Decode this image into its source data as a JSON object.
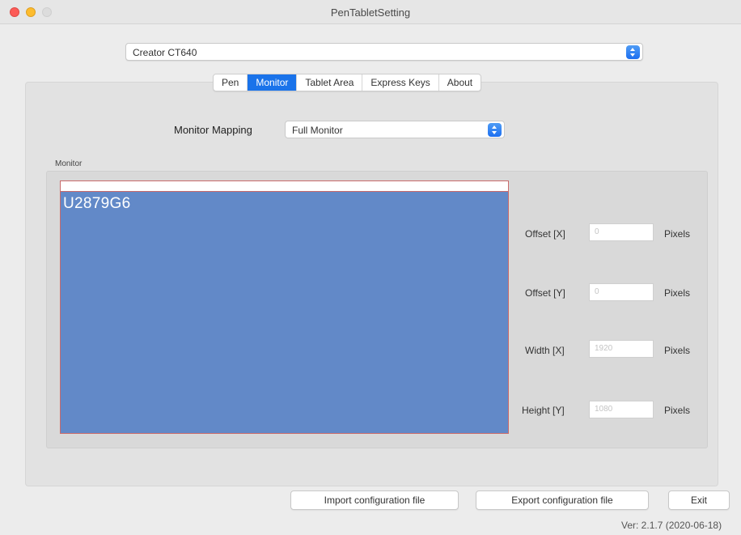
{
  "window": {
    "title": "PenTabletSetting"
  },
  "device": {
    "selected": "Creator CT640"
  },
  "tabs": [
    {
      "label": "Pen",
      "active": false
    },
    {
      "label": "Monitor",
      "active": true
    },
    {
      "label": "Tablet Area",
      "active": false
    },
    {
      "label": "Express Keys",
      "active": false
    },
    {
      "label": "About",
      "active": false
    }
  ],
  "monitor_mapping": {
    "label": "Monitor Mapping",
    "selected": "Full Monitor"
  },
  "monitor_group": {
    "label": "Monitor",
    "display_name": "U2879G6"
  },
  "fields": {
    "offset_x": {
      "label": "Offset [X]",
      "value": "0",
      "unit": "Pixels"
    },
    "offset_y": {
      "label": "Offset [Y]",
      "value": "0",
      "unit": "Pixels"
    },
    "width_x": {
      "label": "Width [X]",
      "value": "1920",
      "unit": "Pixels"
    },
    "height_y": {
      "label": "Height [Y]",
      "value": "1080",
      "unit": "Pixels"
    }
  },
  "buttons": {
    "import": "Import configuration file",
    "export": "Export configuration file",
    "exit": "Exit"
  },
  "version": "Ver: 2.1.7 (2020-06-18)",
  "colors": {
    "accent": "#1a73ea",
    "monitor_fill": "#6289c8"
  }
}
